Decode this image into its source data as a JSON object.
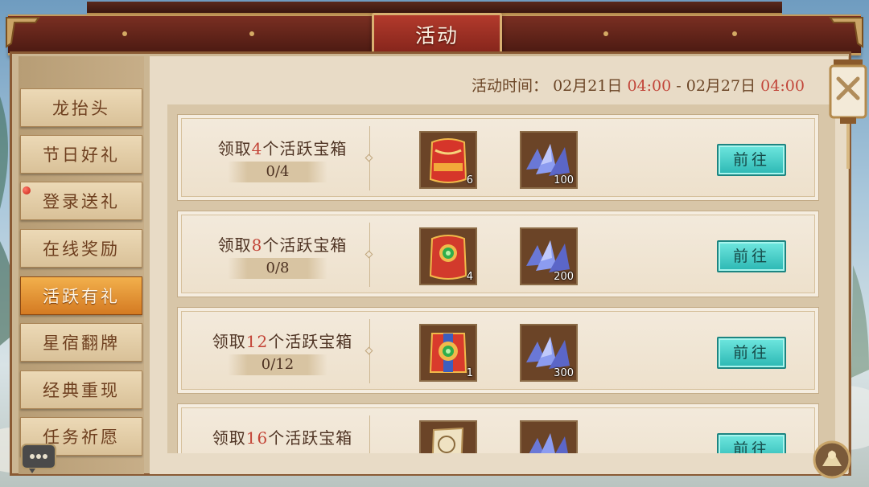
{
  "window": {
    "title": "活动"
  },
  "sidebar": {
    "tabs": [
      {
        "label": "龙抬头",
        "active": false,
        "badge": false
      },
      {
        "label": "节日好礼",
        "active": false,
        "badge": false
      },
      {
        "label": "登录送礼",
        "active": false,
        "badge": true
      },
      {
        "label": "在线奖励",
        "active": false,
        "badge": false
      },
      {
        "label": "活跃有礼",
        "active": true,
        "badge": false
      },
      {
        "label": "星宿翻牌",
        "active": false,
        "badge": false
      },
      {
        "label": "经典重现",
        "active": false,
        "badge": false
      },
      {
        "label": "任务祈愿",
        "active": false,
        "badge": false
      }
    ]
  },
  "event_time": {
    "label": "活动时间：",
    "start_date": "02月21日",
    "start_time": "04:00",
    "separator": "-",
    "end_date": "02月27日",
    "end_time": "04:00"
  },
  "tasks": [
    {
      "prefix": "领取",
      "count": "4",
      "suffix": "个活跃宝箱",
      "progress": "0/4",
      "rewards": [
        {
          "icon": "red-pouch-icon",
          "qty": "6"
        },
        {
          "icon": "blue-crystal-icon",
          "qty": "100"
        }
      ],
      "button": "前往"
    },
    {
      "prefix": "领取",
      "count": "8",
      "suffix": "个活跃宝箱",
      "progress": "0/8",
      "rewards": [
        {
          "icon": "jade-pouch-icon",
          "qty": "4"
        },
        {
          "icon": "blue-crystal-icon",
          "qty": "200"
        }
      ],
      "button": "前往"
    },
    {
      "prefix": "领取",
      "count": "12",
      "suffix": "个活跃宝箱",
      "progress": "0/12",
      "rewards": [
        {
          "icon": "jade-gift-icon",
          "qty": "1"
        },
        {
          "icon": "blue-crystal-icon",
          "qty": "300"
        }
      ],
      "button": "前往"
    },
    {
      "prefix": "领取",
      "count": "16",
      "suffix": "个活跃宝箱",
      "progress": "",
      "rewards": [
        {
          "icon": "scroll-icon",
          "qty": ""
        },
        {
          "icon": "blue-crystal-icon",
          "qty": ""
        }
      ],
      "button": "前往"
    }
  ],
  "colors": {
    "accent_red": "#c34538",
    "go_button": "#3cc8c2",
    "active_tab": "#e9962f"
  }
}
